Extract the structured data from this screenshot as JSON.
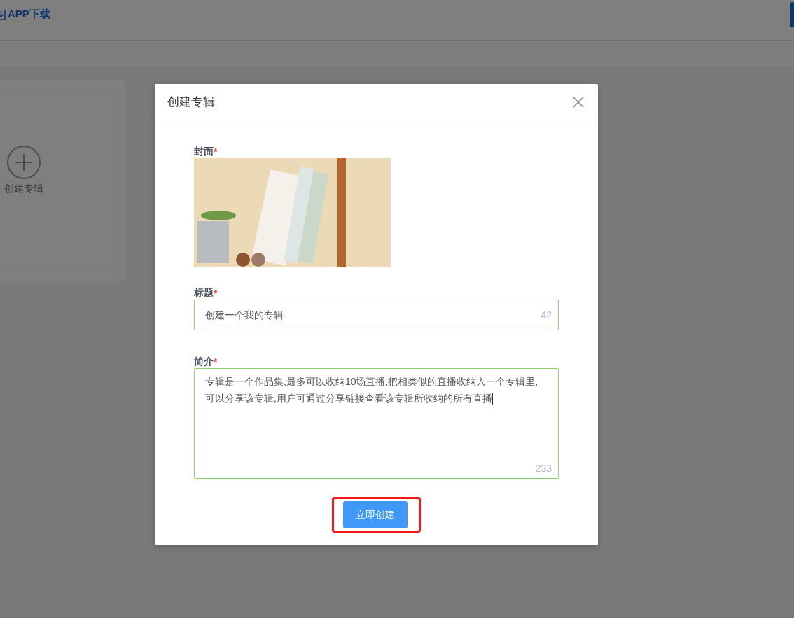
{
  "header": {
    "app_download": "APP下载"
  },
  "album_card": {
    "label": "创建专辑"
  },
  "dialog": {
    "title": "创建专辑",
    "cover": {
      "label": "封面",
      "required_mark": "*"
    },
    "fields": [
      {
        "kind": "input",
        "label": "标题",
        "required_mark": "*",
        "value": "创建一个我的专辑",
        "counter": "42"
      },
      {
        "kind": "textarea",
        "label": "简介",
        "required_mark": "*",
        "value": "专辑是一个作品集,最多可以收纳10场直播,把相类似的直播收纳入一个专辑里,可以分享该专辑,用户可通过分享链接查看该专辑所收纳的所有直播",
        "counter": "233"
      }
    ],
    "submit": {
      "label": "立即创建",
      "highlighted": true
    }
  }
}
